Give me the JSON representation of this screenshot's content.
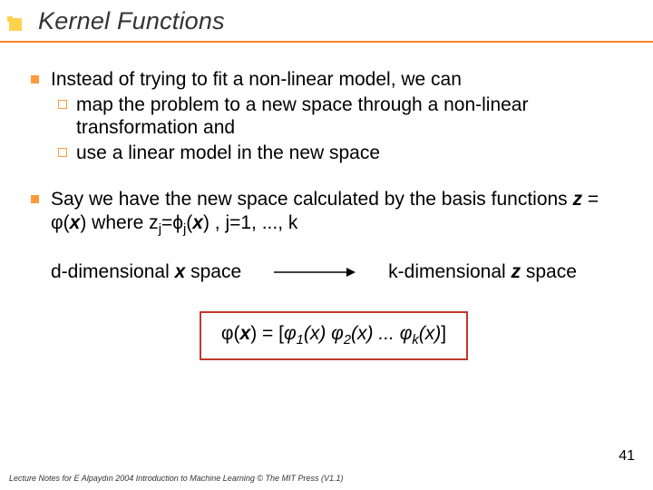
{
  "title": "Kernel Functions",
  "bullets": {
    "b1": {
      "lead": "Instead of trying to fit a non-linear model, we can",
      "sub1": "map the problem to a new space through a non-linear transformation and",
      "sub2": "use a linear model in the new space"
    },
    "b2": {
      "part1": "Say we have the new space calculated by the basis functions ",
      "z_eq": "z",
      "eq_mid": " = ",
      "phi_x": "φ",
      "x_paren_open": "(",
      "x_var": "x",
      "x_paren_close": ")",
      "where": " where z",
      "sub_j1": "j",
      "eq2": "=ϕ",
      "sub_j2": "j",
      "x2_open": "(",
      "x2_var": "x",
      "x2_close": ")",
      "tail": " , j=1, ..., k"
    }
  },
  "mapping": {
    "left_a": "d-dimensional ",
    "left_b": "x",
    "left_c": " space",
    "right_a": "k-dimensional ",
    "right_b": "z",
    "right_c": " space"
  },
  "formula": {
    "phi": "φ",
    "open": "(",
    "x": "x",
    "close": ")",
    "eq": " = [",
    "t1a": "φ",
    "t1s": "1",
    "t1b": "(x) ",
    "t2a": "φ",
    "t2s": "2",
    "t2b": "(x) ... ",
    "tka": "φ",
    "tks": "k",
    "tkb": "(x)",
    "end": "]"
  },
  "footer": "Lecture Notes for E Alpaydın 2004 Introduction to Machine Learning © The MIT Press (V1.1)",
  "page": "41"
}
